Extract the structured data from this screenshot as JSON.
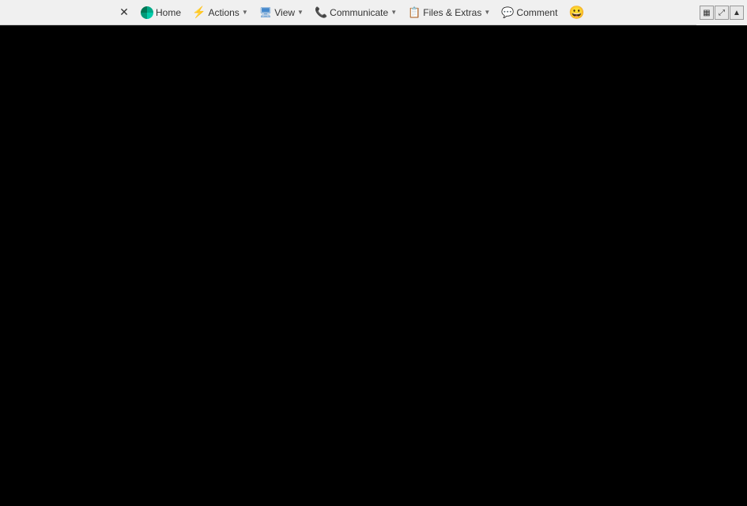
{
  "toolbar": {
    "close_label": "✕",
    "home_label": "Home",
    "actions_label": "Actions",
    "view_label": "View",
    "communicate_label": "Communicate",
    "files_extras_label": "Files & Extras",
    "comment_label": "Comment",
    "emoji_icon": "😀"
  },
  "corner": {
    "grid_icon": "▦",
    "resize_icon": "⤢",
    "up_icon": "▲"
  },
  "background_color": "#000000"
}
